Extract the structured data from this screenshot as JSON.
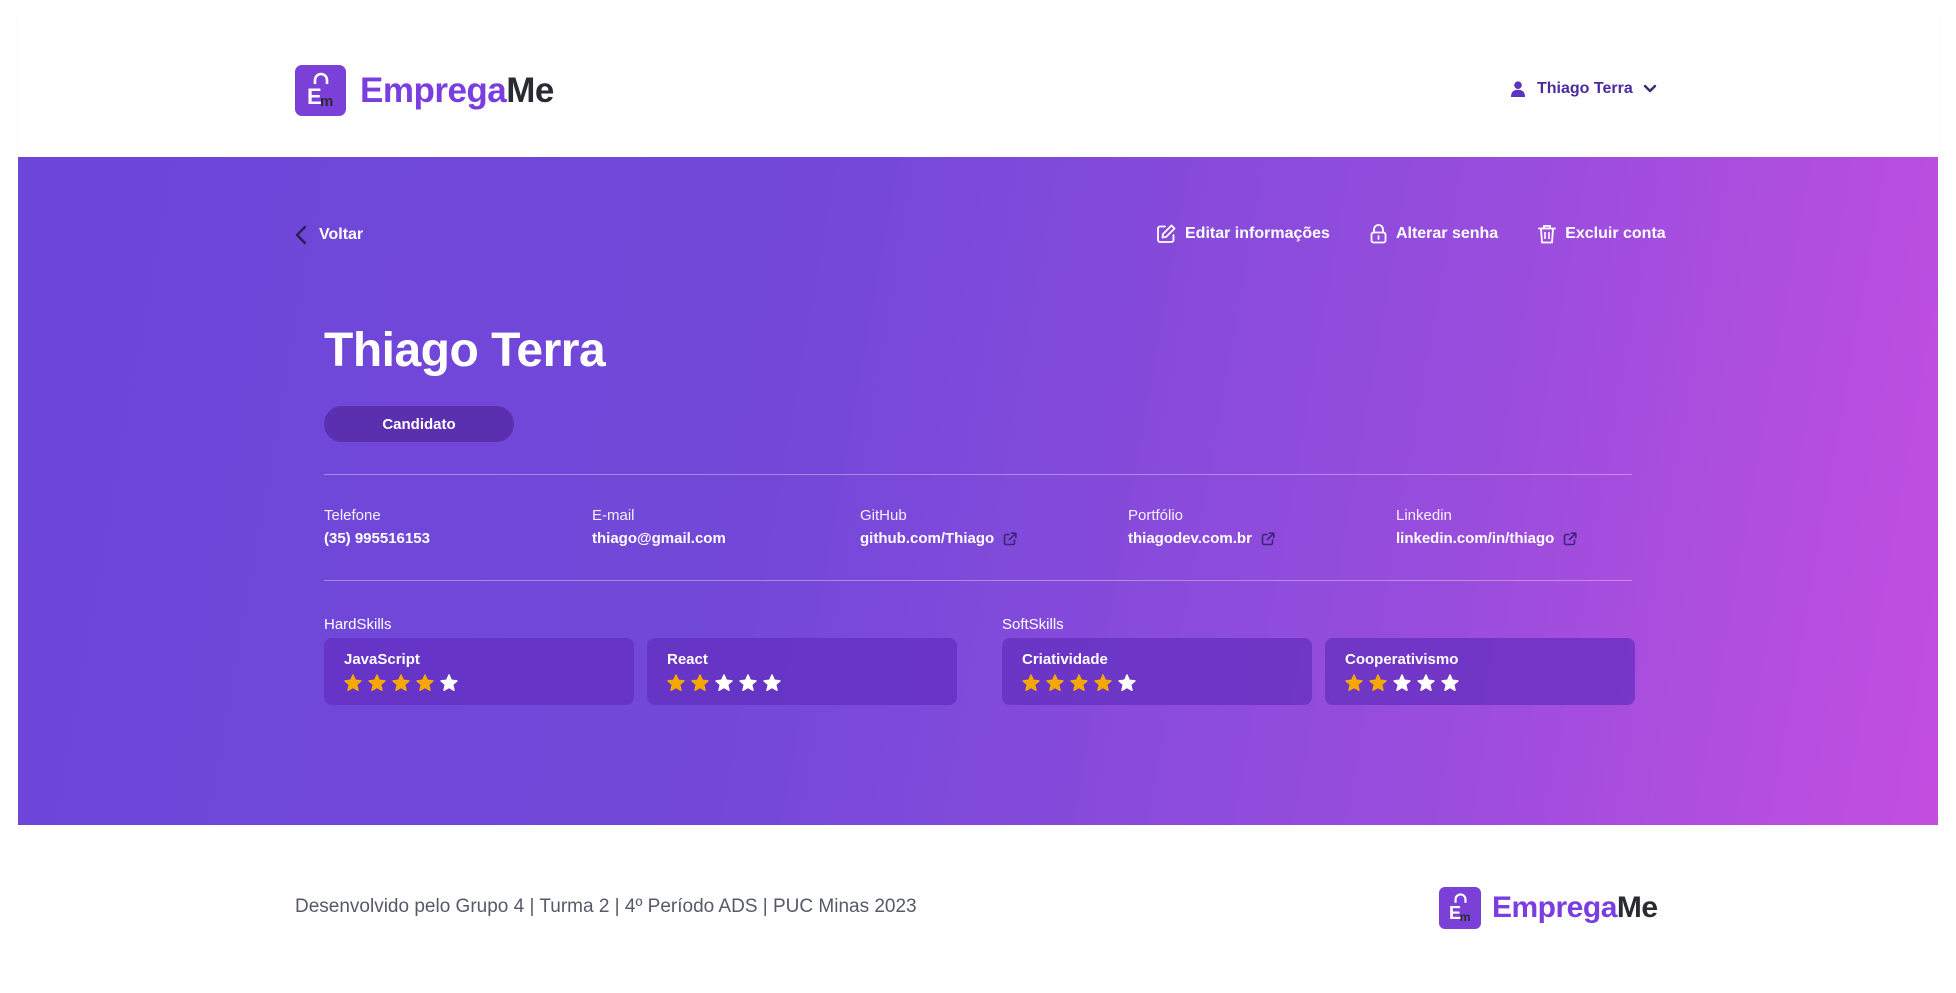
{
  "brand": {
    "part_a": "Emprega",
    "part_b": "Me",
    "accent": "#7a3ee0"
  },
  "header": {
    "user_name": "Thiago Terra",
    "user_icon": "user-icon",
    "menu_icon": "chevron-down-icon"
  },
  "toolbar": {
    "back_label": "Voltar",
    "edit_label": "Editar informações",
    "password_label": "Alterar senha",
    "delete_label": "Excluir conta"
  },
  "profile": {
    "name": "Thiago Terra",
    "role": "Candidato",
    "contacts": [
      {
        "label": "Telefone",
        "value": "(35) 995516153",
        "external_link": false
      },
      {
        "label": "E-mail",
        "value": "thiago@gmail.com",
        "external_link": false
      },
      {
        "label": "GitHub",
        "value": "github.com/Thiago",
        "external_link": true
      },
      {
        "label": "Portfólio",
        "value": "thiagodev.com.br",
        "external_link": true
      },
      {
        "label": "Linkedin",
        "value": "linkedin.com/in/thiago",
        "external_link": true
      }
    ]
  },
  "skills": {
    "hard_title": "HardSkills",
    "soft_title": "SoftSkills",
    "hard": [
      {
        "name": "JavaScript",
        "rating": 4,
        "max": 5
      },
      {
        "name": "React",
        "rating": 2,
        "max": 5
      }
    ],
    "soft": [
      {
        "name": "Criatividade",
        "rating": 4,
        "max": 5
      },
      {
        "name": "Cooperativismo",
        "rating": 2,
        "max": 5
      }
    ]
  },
  "colors": {
    "star_filled": "#f5a800",
    "star_empty": "#ffffff"
  },
  "footer": {
    "credit": "Desenvolvido pelo Grupo 4 | Turma 2 | 4º Período ADS | PUC Minas 2023"
  }
}
